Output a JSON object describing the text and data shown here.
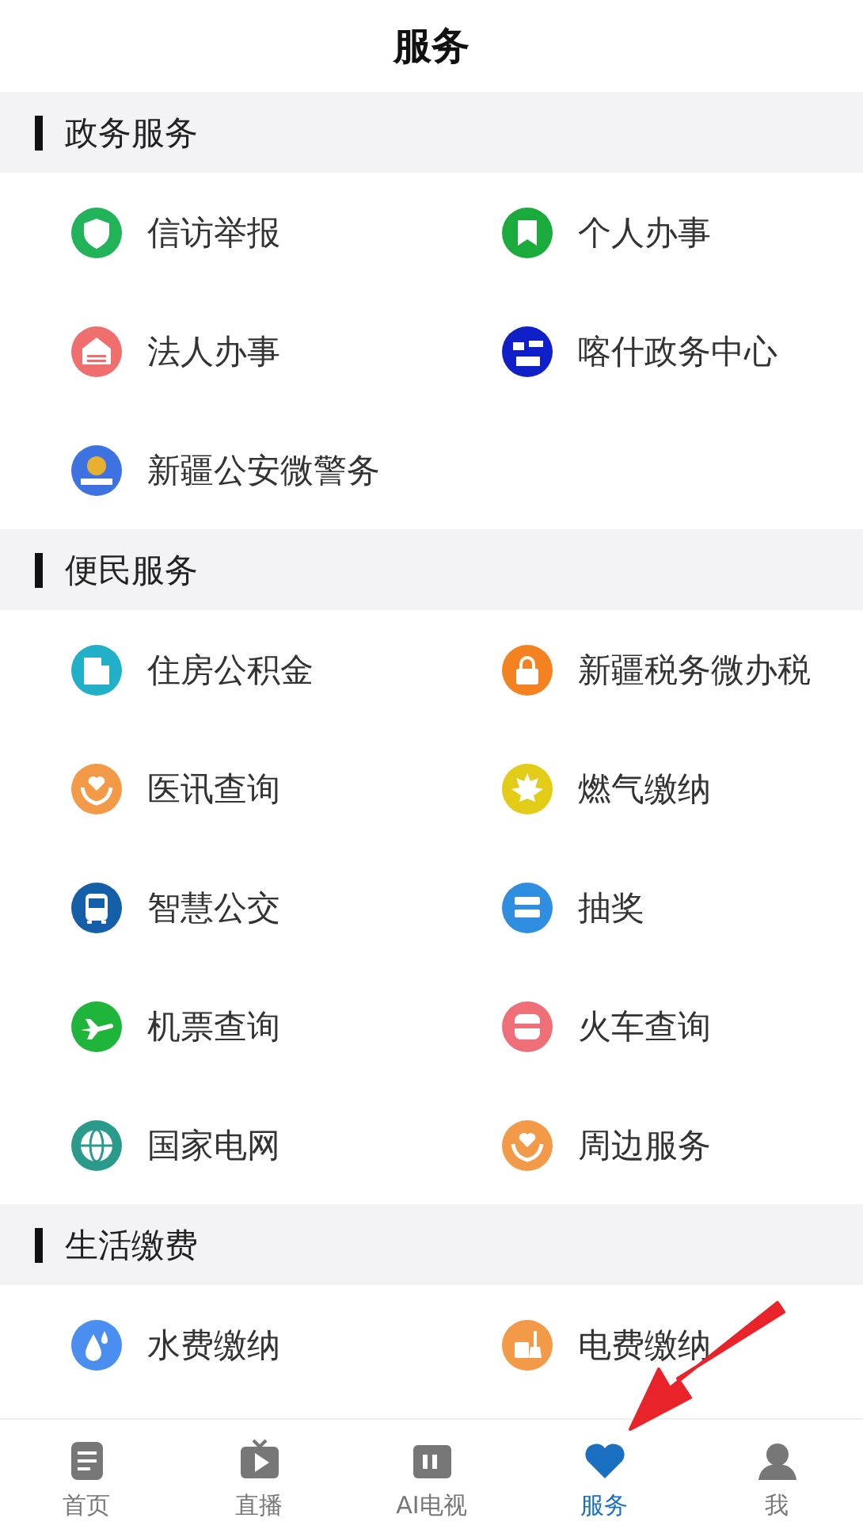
{
  "header": {
    "title": "服务"
  },
  "sections": [
    {
      "title": "政务服务",
      "items": [
        {
          "label": "信访举报"
        },
        {
          "label": "个人办事"
        },
        {
          "label": "法人办事"
        },
        {
          "label": "喀什政务中心"
        },
        {
          "label": "新疆公安微警务"
        }
      ]
    },
    {
      "title": "便民服务",
      "items": [
        {
          "label": "住房公积金"
        },
        {
          "label": "新疆税务微办税"
        },
        {
          "label": "医讯查询"
        },
        {
          "label": "燃气缴纳"
        },
        {
          "label": "智慧公交"
        },
        {
          "label": "抽奖"
        },
        {
          "label": "机票查询"
        },
        {
          "label": "火车查询"
        },
        {
          "label": "国家电网"
        },
        {
          "label": "周边服务"
        }
      ]
    },
    {
      "title": "生活缴费",
      "items": [
        {
          "label": "水费缴纳"
        },
        {
          "label": "电费缴纳"
        }
      ]
    }
  ],
  "tabs": [
    {
      "label": "首页",
      "selected": false
    },
    {
      "label": "直播",
      "selected": false
    },
    {
      "label": "AI电视",
      "selected": false
    },
    {
      "label": "服务",
      "selected": true
    },
    {
      "label": "我",
      "selected": false
    }
  ]
}
